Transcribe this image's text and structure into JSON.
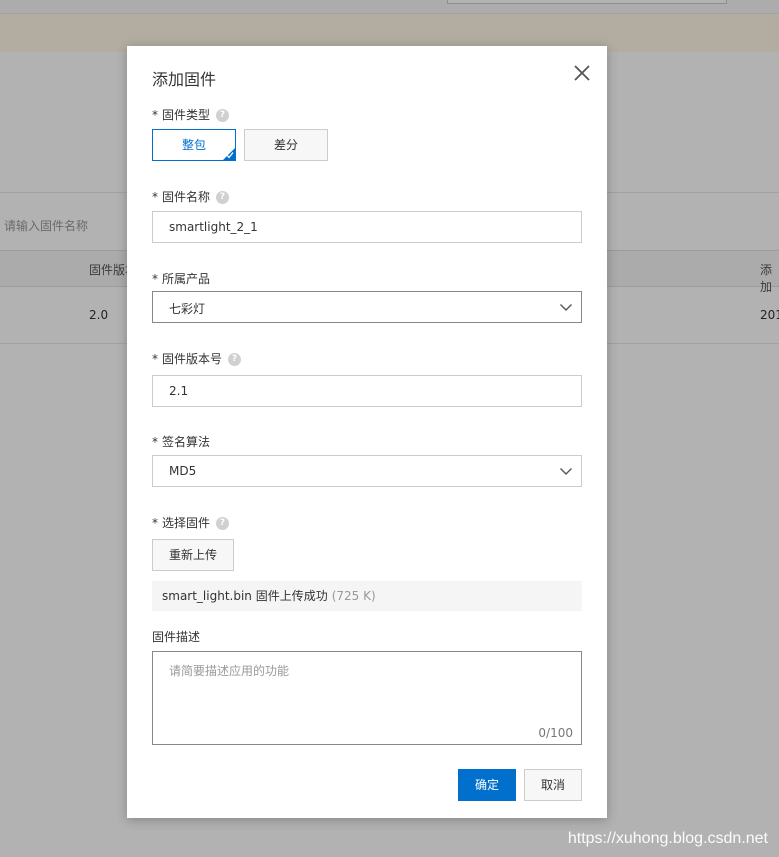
{
  "background": {
    "search_placeholder": "请输入固件名称",
    "table_headers": [
      "固件版本",
      "添加"
    ],
    "table_row": [
      "2.0",
      "201"
    ]
  },
  "watermark": "https://xuhong.blog.csdn.net",
  "dialog": {
    "title": "添加固件",
    "firmware_type": {
      "label": "固件类型",
      "options": [
        "整包",
        "差分"
      ],
      "selected": "整包"
    },
    "firmware_name": {
      "label": "固件名称",
      "value": "smartlight_2_1"
    },
    "product": {
      "label": "所属产品",
      "value": "七彩灯"
    },
    "version": {
      "label": "固件版本号",
      "value": "2.1"
    },
    "signature": {
      "label": "签名算法",
      "value": "MD5"
    },
    "firmware_file": {
      "label": "选择固件",
      "reupload_label": "重新上传",
      "status_text": "smart_light.bin 固件上传成功",
      "size": "(725 K)"
    },
    "description": {
      "label": "固件描述",
      "placeholder": "请简要描述应用的功能",
      "count": "0/100"
    },
    "confirm_label": "确定",
    "cancel_label": "取消"
  },
  "colors": {
    "primary": "#0070cc",
    "overlay": "rgba(0,0,0,0.3)"
  }
}
